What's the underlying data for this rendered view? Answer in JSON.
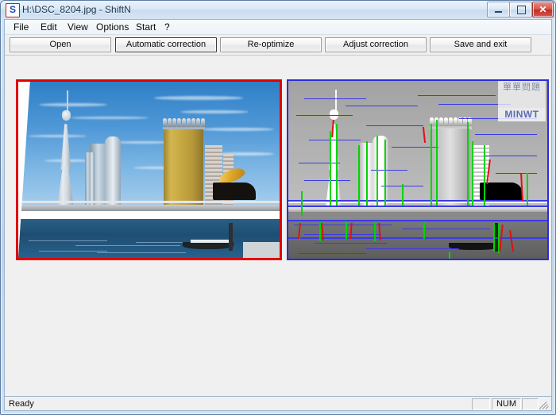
{
  "window": {
    "title": "H:\\DSC_8204.jpg - ShiftN",
    "app_icon_letter": "S",
    "controls": {
      "minimize": "minimize-button",
      "maximize": "maximize-button",
      "close_label": "✕"
    }
  },
  "menu": {
    "items": [
      {
        "label": "File"
      },
      {
        "label": "Edit"
      },
      {
        "label": "View"
      },
      {
        "label": "Options"
      },
      {
        "label": "Start"
      },
      {
        "label": "?"
      }
    ]
  },
  "toolbar": {
    "buttons": [
      {
        "label": "Open",
        "focused": false
      },
      {
        "label": "Automatic correction",
        "focused": true
      },
      {
        "label": "Re-optimize",
        "focused": false
      },
      {
        "label": "Adjust correction",
        "focused": false
      },
      {
        "label": "Save and exit",
        "focused": false
      }
    ]
  },
  "panels": {
    "left": {
      "name": "corrected-image-preview",
      "border_color": "#e00000",
      "description": "Perspective-corrected colour photograph of Tokyo Skytree, Asahi Beer Hall golden building and the Sumida river bridge"
    },
    "right": {
      "name": "line-analysis-preview",
      "border_color": "#2b2be0",
      "description": "Greyscale edge-detection analysis with detected vertical lines highlighted",
      "overlay_colors": {
        "detected_edges": "#3a3ae8",
        "vertical_lines": "#00d400",
        "rejected_lines": "#e01010"
      }
    }
  },
  "watermark": {
    "cjk": "單單問題",
    "text": "MINWT"
  },
  "statusbar": {
    "message": "Ready",
    "panel_1": "",
    "panel_num": "NUM",
    "panel_3": ""
  }
}
